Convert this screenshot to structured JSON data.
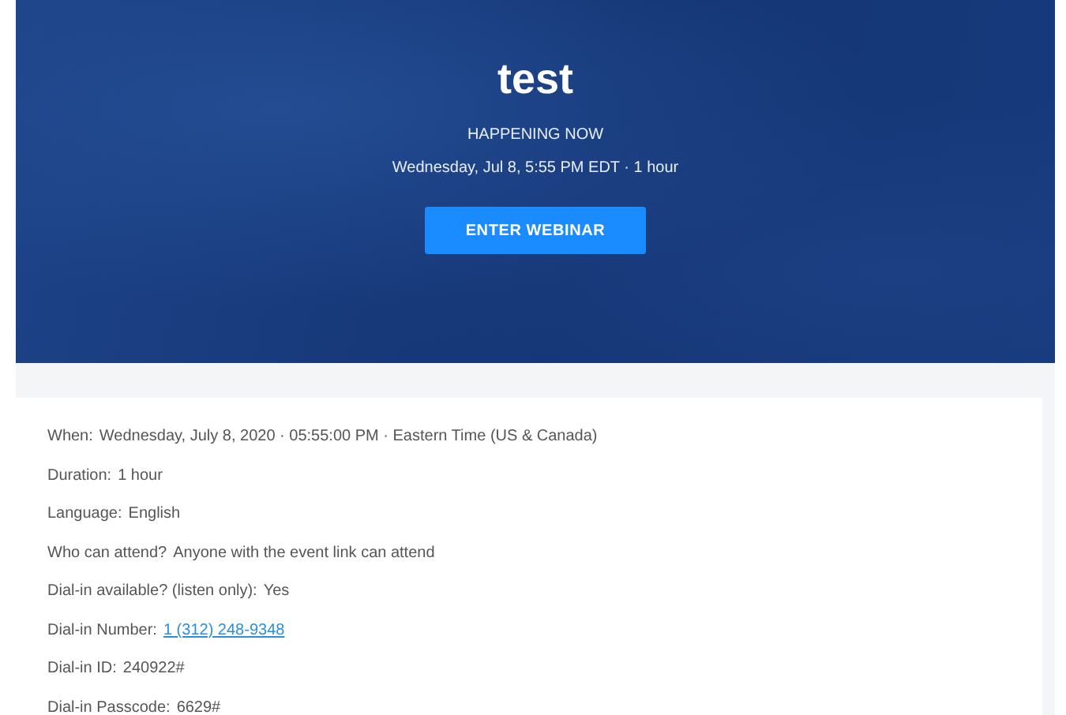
{
  "event": {
    "title": "test",
    "status": "HAPPENING NOW",
    "schedule": "Wednesday, Jul 8, 5:55 PM EDT · 1 hour",
    "button": "ENTER WEBINAR"
  },
  "details": [
    {
      "kind": "text",
      "label": "When:",
      "value": "Wednesday, July 8, 2020 · 05:55:00 PM · Eastern Time (US & Canada)"
    },
    {
      "kind": "text",
      "label": "Duration:",
      "value": "1 hour"
    },
    {
      "kind": "text",
      "label": "Language:",
      "value": "English"
    },
    {
      "kind": "text",
      "label": "Who can attend?",
      "value": "Anyone with the event link can attend"
    },
    {
      "kind": "text",
      "label": "Dial-in available? (listen only):",
      "value": "Yes"
    },
    {
      "kind": "link",
      "label": "Dial-in Number:",
      "value": "1 (312) 248-9348"
    },
    {
      "kind": "text",
      "label": "Dial-in ID:",
      "value": "240922#"
    },
    {
      "kind": "text",
      "label": "Dial-in Passcode:",
      "value": "6629#"
    }
  ]
}
